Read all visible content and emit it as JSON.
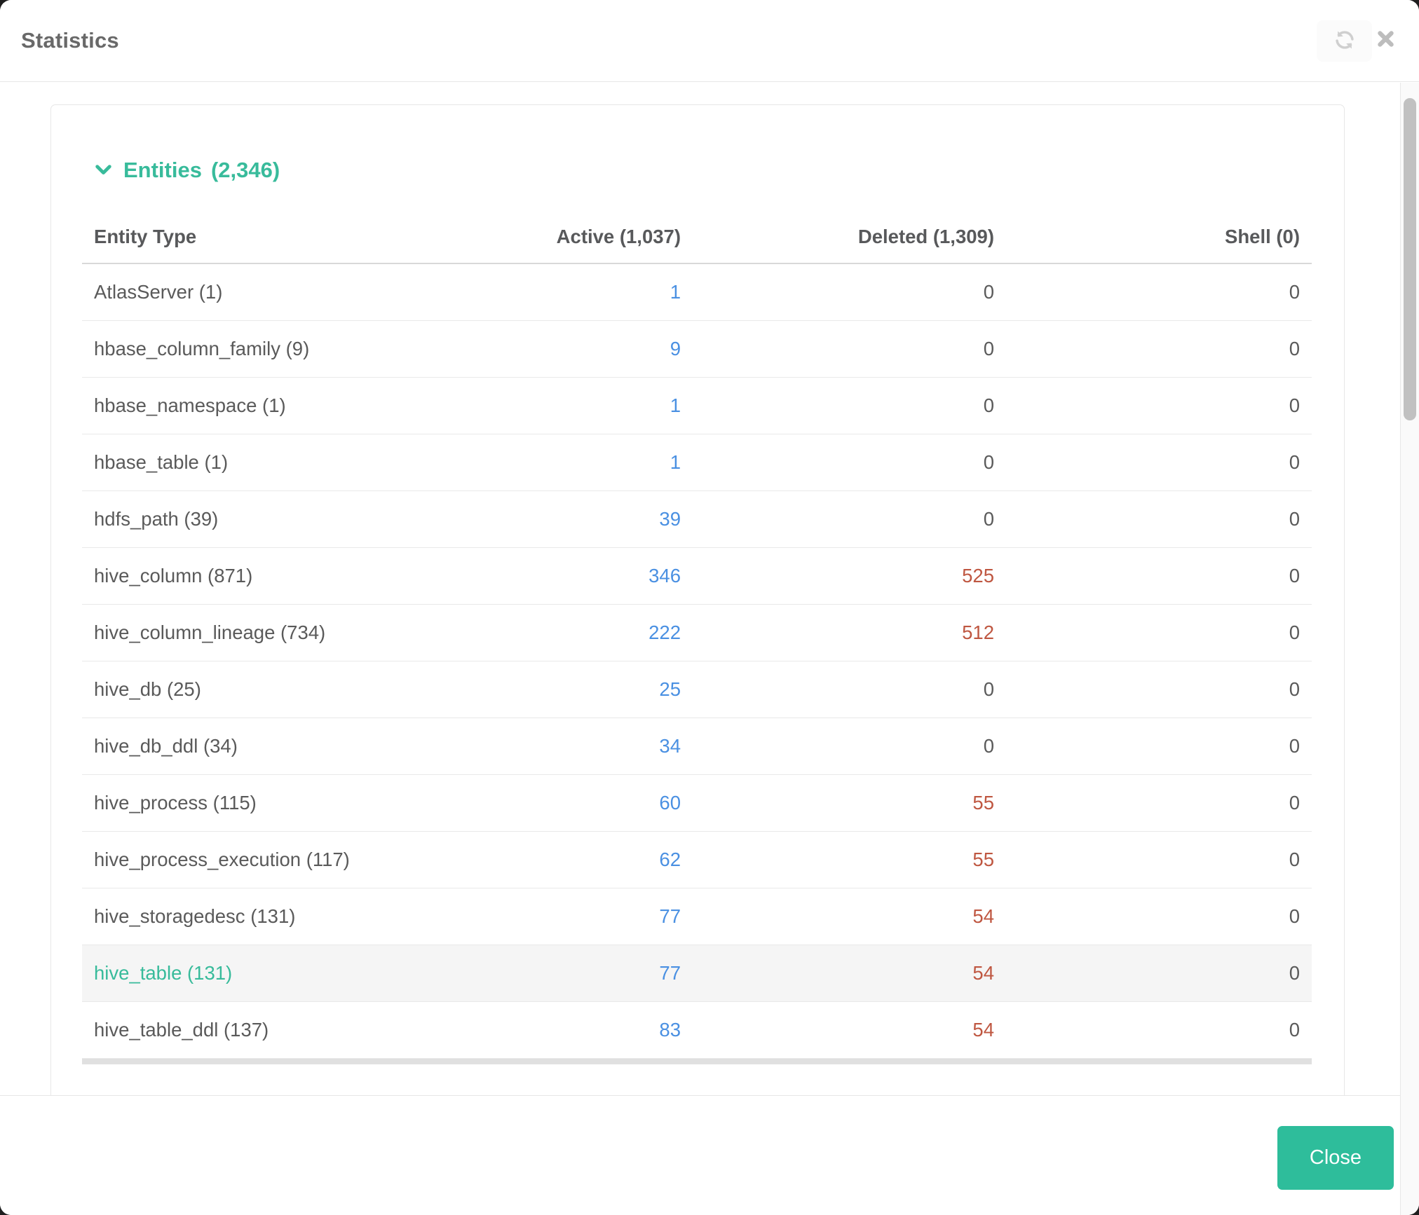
{
  "modal": {
    "title": "Statistics",
    "footer": {
      "close_label": "Close"
    }
  },
  "icons": {
    "refresh": "refresh-icon",
    "close": "close-icon",
    "section_chevron": "chevron-down-icon"
  },
  "colors": {
    "accent_green": "#38bb9b",
    "close_button_green": "#2ebd9b",
    "active_link_blue": "#4a90e2",
    "deleted_red": "#bf5741",
    "row_highlight_bg": "#f5f5f5"
  },
  "entities": {
    "title": "Entities",
    "count": "(2,346)",
    "table": {
      "headers": {
        "entity_type": "Entity Type",
        "active": "Active  (1,037)",
        "deleted": "Deleted  (1,309)",
        "shell": "Shell  (0)"
      },
      "rows": [
        {
          "label": "AtlasServer (1)",
          "active": "1",
          "deleted": "0",
          "shell": "0",
          "highlighted": false
        },
        {
          "label": "hbase_column_family (9)",
          "active": "9",
          "deleted": "0",
          "shell": "0",
          "highlighted": false
        },
        {
          "label": "hbase_namespace (1)",
          "active": "1",
          "deleted": "0",
          "shell": "0",
          "highlighted": false
        },
        {
          "label": "hbase_table (1)",
          "active": "1",
          "deleted": "0",
          "shell": "0",
          "highlighted": false
        },
        {
          "label": "hdfs_path (39)",
          "active": "39",
          "deleted": "0",
          "shell": "0",
          "highlighted": false
        },
        {
          "label": "hive_column (871)",
          "active": "346",
          "deleted": "525",
          "shell": "0",
          "highlighted": false
        },
        {
          "label": "hive_column_lineage (734)",
          "active": "222",
          "deleted": "512",
          "shell": "0",
          "highlighted": false
        },
        {
          "label": "hive_db (25)",
          "active": "25",
          "deleted": "0",
          "shell": "0",
          "highlighted": false
        },
        {
          "label": "hive_db_ddl (34)",
          "active": "34",
          "deleted": "0",
          "shell": "0",
          "highlighted": false
        },
        {
          "label": "hive_process (115)",
          "active": "60",
          "deleted": "55",
          "shell": "0",
          "highlighted": false
        },
        {
          "label": "hive_process_execution (117)",
          "active": "62",
          "deleted": "55",
          "shell": "0",
          "highlighted": false
        },
        {
          "label": "hive_storagedesc (131)",
          "active": "77",
          "deleted": "54",
          "shell": "0",
          "highlighted": false
        },
        {
          "label": "hive_table (131)",
          "active": "77",
          "deleted": "54",
          "shell": "0",
          "highlighted": true
        },
        {
          "label": "hive_table_ddl (137)",
          "active": "83",
          "deleted": "54",
          "shell": "0",
          "highlighted": false
        }
      ]
    }
  }
}
